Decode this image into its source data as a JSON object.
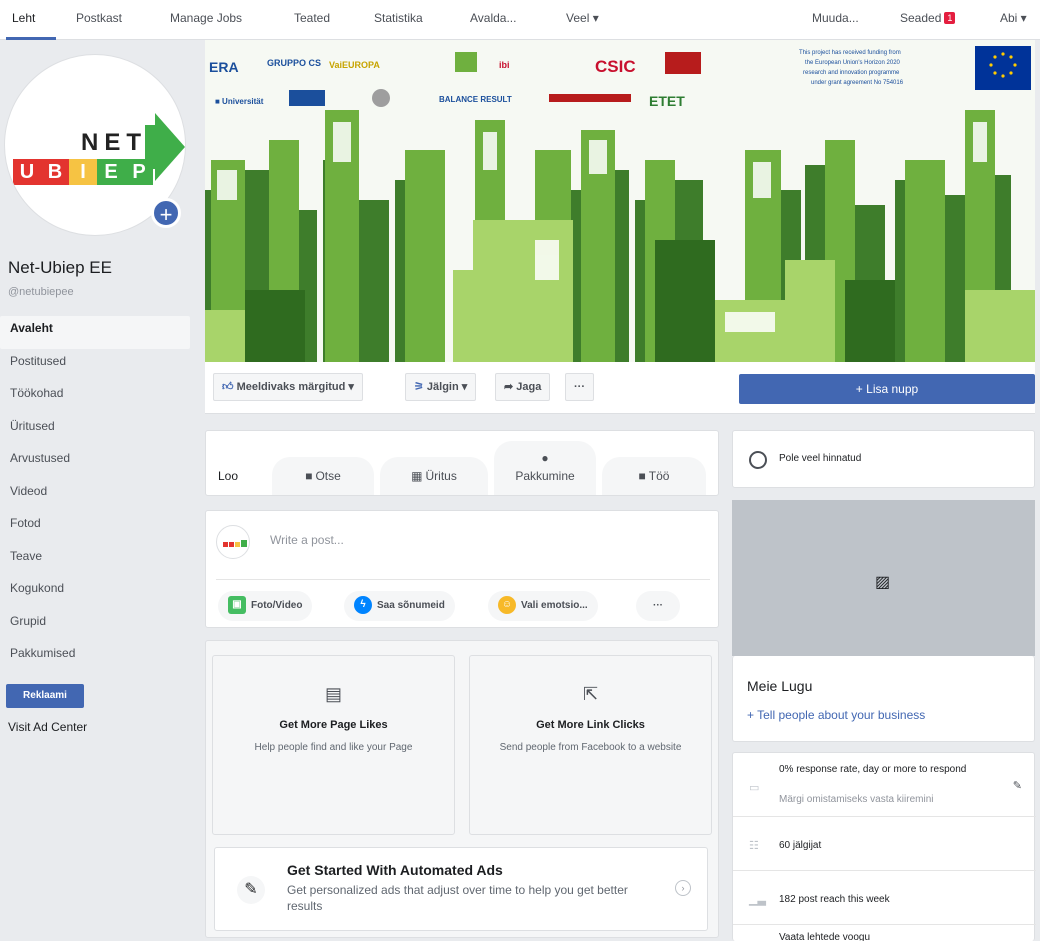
{
  "topnav": {
    "tabs": [
      "Leht",
      "Postkast",
      "Manage Jobs",
      "Teated",
      "Statistika",
      "Avalda...",
      "Veel ▾"
    ],
    "right": {
      "edit": "Muuda...",
      "settings": "Seaded",
      "settings_badge": "1",
      "help": "Abi ▾"
    }
  },
  "sidebar": {
    "logo": {
      "top": "NET",
      "letters": [
        "U",
        "B",
        "I",
        "E",
        "P"
      ],
      "colors": [
        "#e3342f",
        "#e3342f",
        "#f6c343",
        "#3fae49",
        "#3fae49"
      ]
    },
    "page_name": "Net-Ubiep EE",
    "handle": "@netubiepee",
    "items": [
      "Avaleht",
      "Postitused",
      "Töökohad",
      "Üritused",
      "Arvustused",
      "Videod",
      "Fotod",
      "Teave",
      "Kogukond",
      "Grupid",
      "Pakkumised"
    ],
    "promote": "Reklaami",
    "ad_center": "Visit Ad Center"
  },
  "cover": {
    "partner_logos": [
      "CSIC",
      "ETET",
      "BALANCE RESULT",
      "GRUPPO CS"
    ],
    "funding_text": "This project has received funding from the European Union's Horizon 2020 research and innovation programme under grant agreement No 754016"
  },
  "actions": {
    "liked": "Meeldivaks märgitud ▾",
    "follow": "Jälgin ▾",
    "share": "Jaga",
    "more": "···",
    "add_button": "+ Lisa nupp"
  },
  "create": {
    "label": "Loo",
    "tabs": [
      {
        "icon": "■",
        "label": "Otse"
      },
      {
        "icon": "▦",
        "label": "Üritus"
      },
      {
        "icon": "●",
        "label": "Pakkumine"
      },
      {
        "icon": "■",
        "label": "Töö"
      }
    ]
  },
  "composer": {
    "placeholder": "Write a post...",
    "actions": [
      {
        "label": "Foto/Video",
        "color": "#45bd62"
      },
      {
        "label": "Saa sõnumeid",
        "color": "#0084ff"
      },
      {
        "label": "Vali emotsio...",
        "color": "#f7b928"
      },
      {
        "label": "···",
        "color": ""
      }
    ]
  },
  "promos": [
    {
      "icon": "▤",
      "title": "Get More Page Likes",
      "desc": "Help people find and like your Page"
    },
    {
      "icon": "⇱",
      "title": "Get More Link Clicks",
      "desc": "Send people from Facebook to a website"
    }
  ],
  "auto_ads": {
    "title": "Get Started With Automated Ads",
    "desc": "Get personalized ads that adjust over time to help you get better results",
    "arrow": "›"
  },
  "right": {
    "rating": "Pole veel hinnatud",
    "story_title": "Meie Lugu",
    "story_link": "+ Tell people about your business",
    "stats": [
      {
        "text": "0% response rate, day or more to respond",
        "sub": "Märgi omistamiseks vasta kiiremini"
      },
      {
        "text": "60 jälgijat",
        "sub": ""
      },
      {
        "text": "182 post reach this week",
        "sub": ""
      },
      {
        "text": "Vaata lehtede voogu",
        "sub": ""
      }
    ]
  },
  "colors": {
    "brand": "#4267b2",
    "green_dark": "#2e7d32",
    "green_mid": "#6db33f",
    "green_light": "#a5d36a"
  }
}
